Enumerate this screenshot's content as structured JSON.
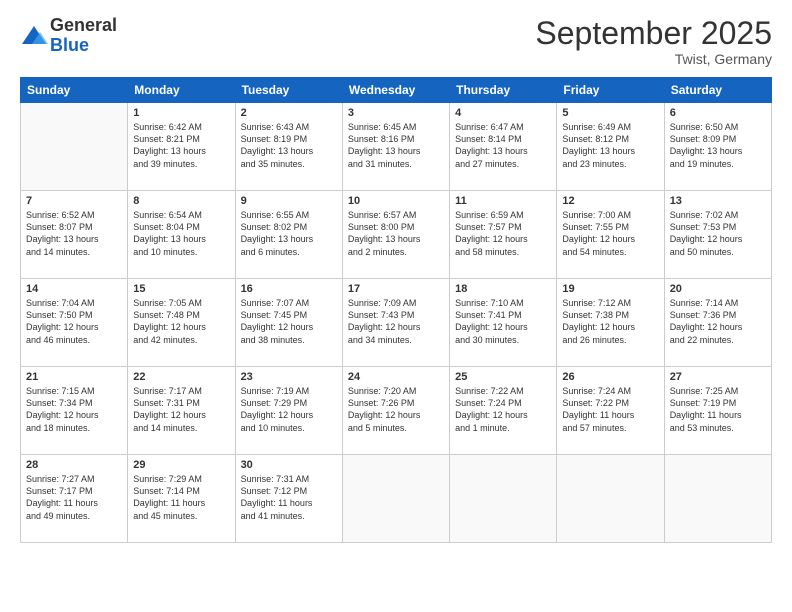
{
  "logo": {
    "general": "General",
    "blue": "Blue"
  },
  "title": "September 2025",
  "subtitle": "Twist, Germany",
  "days": [
    "Sunday",
    "Monday",
    "Tuesday",
    "Wednesday",
    "Thursday",
    "Friday",
    "Saturday"
  ],
  "weeks": [
    [
      {
        "day": "",
        "empty": true,
        "content": ""
      },
      {
        "day": "1",
        "empty": false,
        "content": "Sunrise: 6:42 AM\nSunset: 8:21 PM\nDaylight: 13 hours\nand 39 minutes."
      },
      {
        "day": "2",
        "empty": false,
        "content": "Sunrise: 6:43 AM\nSunset: 8:19 PM\nDaylight: 13 hours\nand 35 minutes."
      },
      {
        "day": "3",
        "empty": false,
        "content": "Sunrise: 6:45 AM\nSunset: 8:16 PM\nDaylight: 13 hours\nand 31 minutes."
      },
      {
        "day": "4",
        "empty": false,
        "content": "Sunrise: 6:47 AM\nSunset: 8:14 PM\nDaylight: 13 hours\nand 27 minutes."
      },
      {
        "day": "5",
        "empty": false,
        "content": "Sunrise: 6:49 AM\nSunset: 8:12 PM\nDaylight: 13 hours\nand 23 minutes."
      },
      {
        "day": "6",
        "empty": false,
        "content": "Sunrise: 6:50 AM\nSunset: 8:09 PM\nDaylight: 13 hours\nand 19 minutes."
      }
    ],
    [
      {
        "day": "7",
        "empty": false,
        "content": "Sunrise: 6:52 AM\nSunset: 8:07 PM\nDaylight: 13 hours\nand 14 minutes."
      },
      {
        "day": "8",
        "empty": false,
        "content": "Sunrise: 6:54 AM\nSunset: 8:04 PM\nDaylight: 13 hours\nand 10 minutes."
      },
      {
        "day": "9",
        "empty": false,
        "content": "Sunrise: 6:55 AM\nSunset: 8:02 PM\nDaylight: 13 hours\nand 6 minutes."
      },
      {
        "day": "10",
        "empty": false,
        "content": "Sunrise: 6:57 AM\nSunset: 8:00 PM\nDaylight: 13 hours\nand 2 minutes."
      },
      {
        "day": "11",
        "empty": false,
        "content": "Sunrise: 6:59 AM\nSunset: 7:57 PM\nDaylight: 12 hours\nand 58 minutes."
      },
      {
        "day": "12",
        "empty": false,
        "content": "Sunrise: 7:00 AM\nSunset: 7:55 PM\nDaylight: 12 hours\nand 54 minutes."
      },
      {
        "day": "13",
        "empty": false,
        "content": "Sunrise: 7:02 AM\nSunset: 7:53 PM\nDaylight: 12 hours\nand 50 minutes."
      }
    ],
    [
      {
        "day": "14",
        "empty": false,
        "content": "Sunrise: 7:04 AM\nSunset: 7:50 PM\nDaylight: 12 hours\nand 46 minutes."
      },
      {
        "day": "15",
        "empty": false,
        "content": "Sunrise: 7:05 AM\nSunset: 7:48 PM\nDaylight: 12 hours\nand 42 minutes."
      },
      {
        "day": "16",
        "empty": false,
        "content": "Sunrise: 7:07 AM\nSunset: 7:45 PM\nDaylight: 12 hours\nand 38 minutes."
      },
      {
        "day": "17",
        "empty": false,
        "content": "Sunrise: 7:09 AM\nSunset: 7:43 PM\nDaylight: 12 hours\nand 34 minutes."
      },
      {
        "day": "18",
        "empty": false,
        "content": "Sunrise: 7:10 AM\nSunset: 7:41 PM\nDaylight: 12 hours\nand 30 minutes."
      },
      {
        "day": "19",
        "empty": false,
        "content": "Sunrise: 7:12 AM\nSunset: 7:38 PM\nDaylight: 12 hours\nand 26 minutes."
      },
      {
        "day": "20",
        "empty": false,
        "content": "Sunrise: 7:14 AM\nSunset: 7:36 PM\nDaylight: 12 hours\nand 22 minutes."
      }
    ],
    [
      {
        "day": "21",
        "empty": false,
        "content": "Sunrise: 7:15 AM\nSunset: 7:34 PM\nDaylight: 12 hours\nand 18 minutes."
      },
      {
        "day": "22",
        "empty": false,
        "content": "Sunrise: 7:17 AM\nSunset: 7:31 PM\nDaylight: 12 hours\nand 14 minutes."
      },
      {
        "day": "23",
        "empty": false,
        "content": "Sunrise: 7:19 AM\nSunset: 7:29 PM\nDaylight: 12 hours\nand 10 minutes."
      },
      {
        "day": "24",
        "empty": false,
        "content": "Sunrise: 7:20 AM\nSunset: 7:26 PM\nDaylight: 12 hours\nand 5 minutes."
      },
      {
        "day": "25",
        "empty": false,
        "content": "Sunrise: 7:22 AM\nSunset: 7:24 PM\nDaylight: 12 hours\nand 1 minute."
      },
      {
        "day": "26",
        "empty": false,
        "content": "Sunrise: 7:24 AM\nSunset: 7:22 PM\nDaylight: 11 hours\nand 57 minutes."
      },
      {
        "day": "27",
        "empty": false,
        "content": "Sunrise: 7:25 AM\nSunset: 7:19 PM\nDaylight: 11 hours\nand 53 minutes."
      }
    ],
    [
      {
        "day": "28",
        "empty": false,
        "content": "Sunrise: 7:27 AM\nSunset: 7:17 PM\nDaylight: 11 hours\nand 49 minutes."
      },
      {
        "day": "29",
        "empty": false,
        "content": "Sunrise: 7:29 AM\nSunset: 7:14 PM\nDaylight: 11 hours\nand 45 minutes."
      },
      {
        "day": "30",
        "empty": false,
        "content": "Sunrise: 7:31 AM\nSunset: 7:12 PM\nDaylight: 11 hours\nand 41 minutes."
      },
      {
        "day": "",
        "empty": true,
        "content": ""
      },
      {
        "day": "",
        "empty": true,
        "content": ""
      },
      {
        "day": "",
        "empty": true,
        "content": ""
      },
      {
        "day": "",
        "empty": true,
        "content": ""
      }
    ]
  ]
}
